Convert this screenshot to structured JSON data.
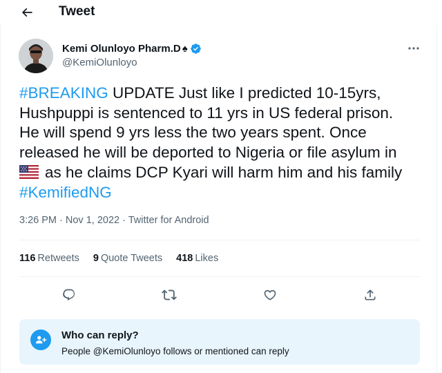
{
  "header": {
    "title": "Tweet",
    "back_icon": "arrow-left-icon"
  },
  "author": {
    "display_name": "Kemi Olunloyo Pharm.D",
    "badge_emoji": "♠",
    "handle": "@KemiOlunloyo",
    "verified": true,
    "verified_color": "#1d9bf0",
    "avatar_icon": "avatar-icon"
  },
  "tweet": {
    "hashtag_breaking": "#BREAKING",
    "line1_rest": " UPDATE Just like I predicted 10-15yrs,",
    "line2": "Hushpuppi is sentenced to 11 yrs in US federal prison.",
    "line3": "He will spend 9 yrs less the two years spent. Once",
    "line4": "released he will be deported to Nigeria or file asylum in",
    "flag_icon": "us-flag-icon",
    "line5_rest": "as he claims DCP Kyari will harm him and his family",
    "hashtag_kemified": "#KemifiedNG",
    "link_color": "#1d9bf0"
  },
  "meta": {
    "time": "3:26 PM",
    "sep1": " · ",
    "date": "Nov 1, 2022",
    "sep2": " · ",
    "source": "Twitter for Android"
  },
  "stats": {
    "retweets_count": "116",
    "retweets_label": "Retweets",
    "quotes_count": "9",
    "quotes_label": "Quote Tweets",
    "likes_count": "418",
    "likes_label": "Likes"
  },
  "actions": {
    "reply_icon": "reply-icon",
    "retweet_icon": "retweet-icon",
    "like_icon": "heart-icon",
    "share_icon": "share-icon"
  },
  "reply_notice": {
    "title": "Who can reply?",
    "description": "People @KemiOlunloyo follows or mentioned can reply",
    "icon": "people-icon",
    "background": "#e8f5fd"
  },
  "more_icon": "more-icon"
}
